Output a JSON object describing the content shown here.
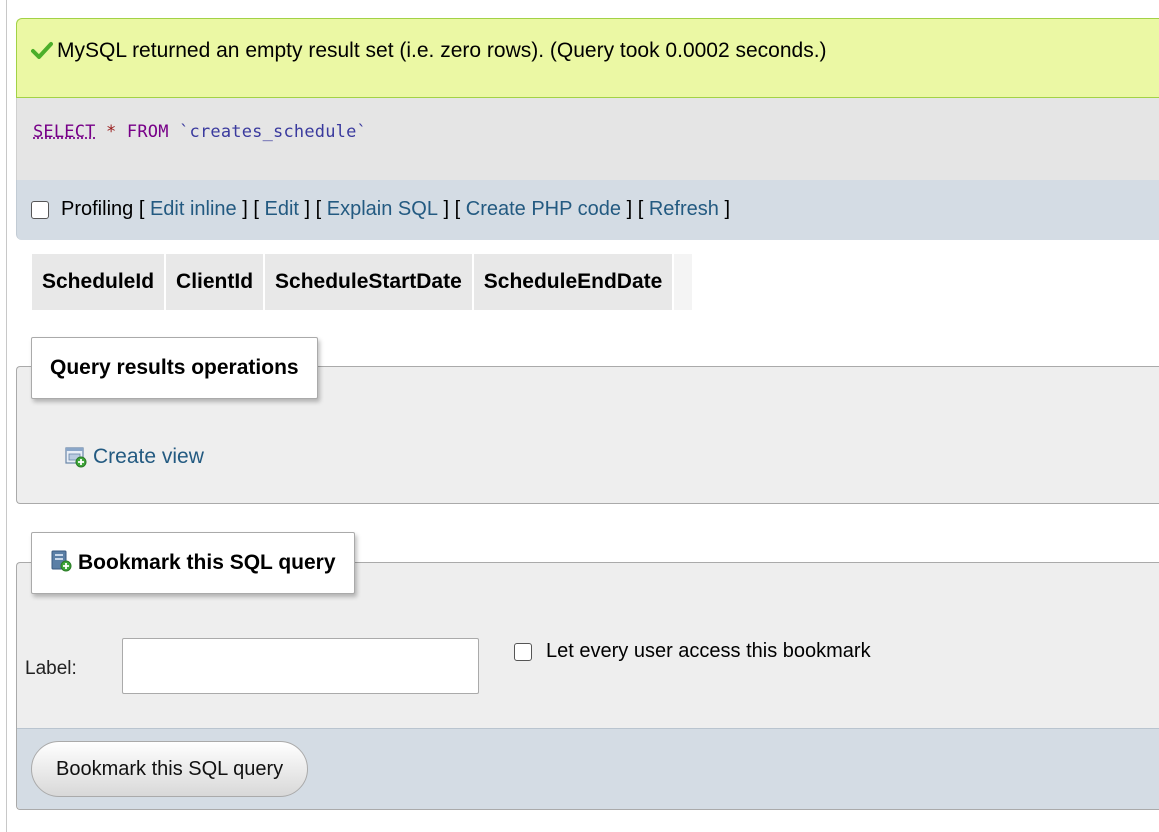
{
  "message": {
    "icon": "success-check-icon",
    "text": "MySQL returned an empty result set (i.e. zero rows). (Query took 0.0002 seconds.)"
  },
  "sql": {
    "select": "SELECT",
    "star": "*",
    "from": "FROM",
    "table": "`creates_schedule`"
  },
  "tools": {
    "profiling_label": "Profiling",
    "open_bracket": "[",
    "close_bracket": "]",
    "links": [
      "Edit inline",
      "Edit",
      "Explain SQL",
      "Create PHP code",
      "Refresh"
    ]
  },
  "table": {
    "columns": [
      "ScheduleId",
      "ClientId",
      "ScheduleStartDate",
      "ScheduleEndDate"
    ]
  },
  "query_ops": {
    "legend": "Query results operations",
    "create_view": "Create view"
  },
  "bookmark": {
    "legend": "Bookmark this SQL query",
    "label_text": "Label:",
    "label_value": "",
    "share_text": "Let every user access this bookmark",
    "submit": "Bookmark this SQL query"
  },
  "colors": {
    "success_bg": "#ebf8a4",
    "link": "#235a81",
    "toolbar_bg": "#d4dce4"
  }
}
